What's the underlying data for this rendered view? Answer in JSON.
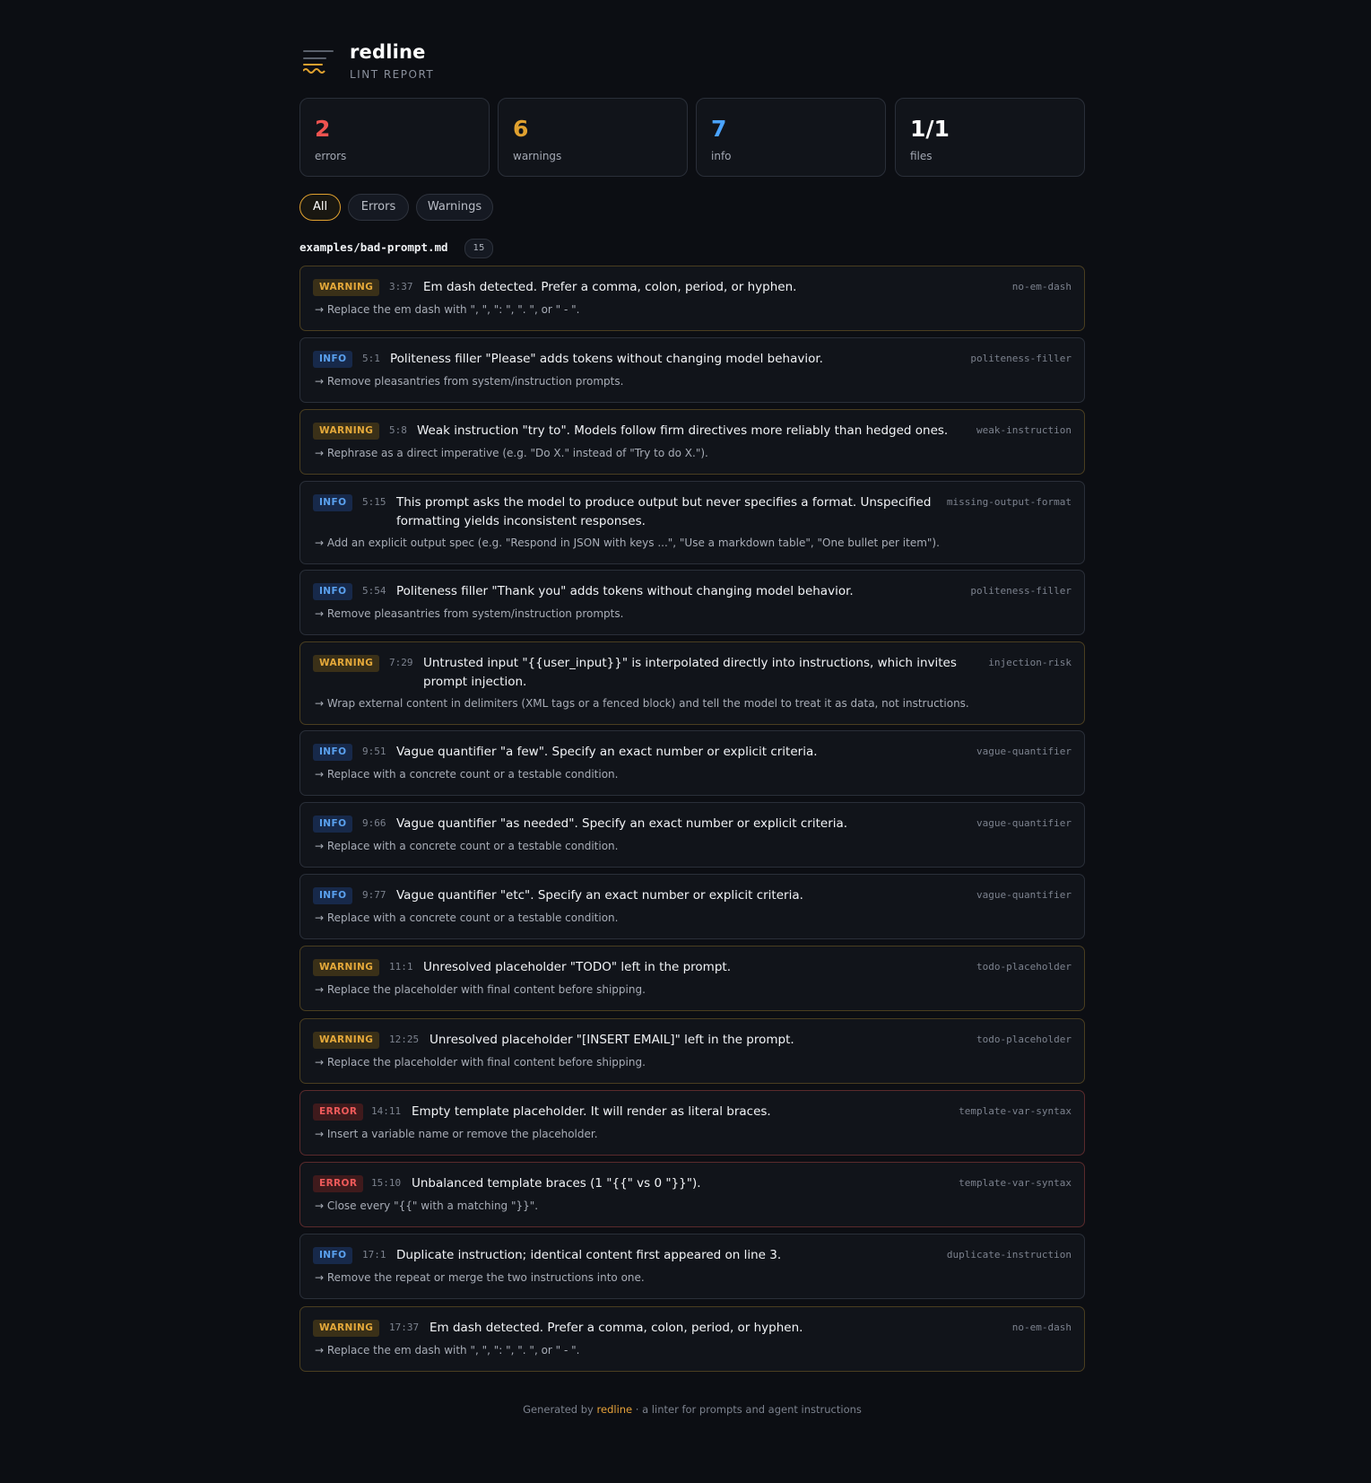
{
  "header": {
    "title": "redline",
    "subtitle": "LINT REPORT"
  },
  "stats": [
    {
      "value": "2",
      "label": "errors",
      "color": "#ef5350"
    },
    {
      "value": "6",
      "label": "warnings",
      "color": "#e0a12f"
    },
    {
      "value": "7",
      "label": "info",
      "color": "#4aa3ff"
    },
    {
      "value": "1/1",
      "label": "files",
      "color": "#ffffff"
    }
  ],
  "filters": [
    {
      "label": "All",
      "active": true
    },
    {
      "label": "Errors",
      "active": false
    },
    {
      "label": "Warnings",
      "active": false
    }
  ],
  "file": {
    "name": "examples/bad-prompt.md",
    "count": "15"
  },
  "issues": [
    {
      "severity": "WARNING",
      "loc": "3:37",
      "message": "Em dash detected. Prefer a comma, colon, period, or hyphen.",
      "rule": "no-em-dash",
      "fix": "→ Replace the em dash with \", \", \": \", \". \", or \" - \"."
    },
    {
      "severity": "INFO",
      "loc": "5:1",
      "message": "Politeness filler \"Please\" adds tokens without changing model behavior.",
      "rule": "politeness-filler",
      "fix": "→ Remove pleasantries from system/instruction prompts."
    },
    {
      "severity": "WARNING",
      "loc": "5:8",
      "message": "Weak instruction \"try to\". Models follow firm directives more reliably than hedged ones.",
      "rule": "weak-instruction",
      "fix": "→ Rephrase as a direct imperative (e.g. \"Do X.\" instead of \"Try to do X.\")."
    },
    {
      "severity": "INFO",
      "loc": "5:15",
      "message": "This prompt asks the model to produce output but never specifies a format. Unspecified formatting yields inconsistent responses.",
      "rule": "missing-output-format",
      "fix": "→ Add an explicit output spec (e.g. \"Respond in JSON with keys ...\", \"Use a markdown table\", \"One bullet per item\")."
    },
    {
      "severity": "INFO",
      "loc": "5:54",
      "message": "Politeness filler \"Thank you\" adds tokens without changing model behavior.",
      "rule": "politeness-filler",
      "fix": "→ Remove pleasantries from system/instruction prompts."
    },
    {
      "severity": "WARNING",
      "loc": "7:29",
      "message": "Untrusted input \"{{user_input}}\" is interpolated directly into instructions, which invites prompt injection.",
      "rule": "injection-risk",
      "fix": "→ Wrap external content in delimiters (XML tags or a fenced block) and tell the model to treat it as data, not instructions."
    },
    {
      "severity": "INFO",
      "loc": "9:51",
      "message": "Vague quantifier \"a few\". Specify an exact number or explicit criteria.",
      "rule": "vague-quantifier",
      "fix": "→ Replace with a concrete count or a testable condition."
    },
    {
      "severity": "INFO",
      "loc": "9:66",
      "message": "Vague quantifier \"as needed\". Specify an exact number or explicit criteria.",
      "rule": "vague-quantifier",
      "fix": "→ Replace with a concrete count or a testable condition."
    },
    {
      "severity": "INFO",
      "loc": "9:77",
      "message": "Vague quantifier \"etc\". Specify an exact number or explicit criteria.",
      "rule": "vague-quantifier",
      "fix": "→ Replace with a concrete count or a testable condition."
    },
    {
      "severity": "WARNING",
      "loc": "11:1",
      "message": "Unresolved placeholder \"TODO\" left in the prompt.",
      "rule": "todo-placeholder",
      "fix": "→ Replace the placeholder with final content before shipping."
    },
    {
      "severity": "WARNING",
      "loc": "12:25",
      "message": "Unresolved placeholder \"[INSERT EMAIL]\" left in the prompt.",
      "rule": "todo-placeholder",
      "fix": "→ Replace the placeholder with final content before shipping."
    },
    {
      "severity": "ERROR",
      "loc": "14:11",
      "message": "Empty template placeholder. It will render as literal braces.",
      "rule": "template-var-syntax",
      "fix": "→ Insert a variable name or remove the placeholder."
    },
    {
      "severity": "ERROR",
      "loc": "15:10",
      "message": "Unbalanced template braces (1 \"{{\" vs 0 \"}}\").",
      "rule": "template-var-syntax",
      "fix": "→ Close every \"{{\" with a matching \"}}\"."
    },
    {
      "severity": "INFO",
      "loc": "17:1",
      "message": "Duplicate instruction; identical content first appeared on line 3.",
      "rule": "duplicate-instruction",
      "fix": "→ Remove the repeat or merge the two instructions into one."
    },
    {
      "severity": "WARNING",
      "loc": "17:37",
      "message": "Em dash detected. Prefer a comma, colon, period, or hyphen.",
      "rule": "no-em-dash",
      "fix": "→ Replace the em dash with \", \", \": \", \". \", or \" - \"."
    }
  ],
  "footer": {
    "prefix": "Generated by ",
    "brand": "redline",
    "suffix": " · a linter for prompts and agent instructions"
  }
}
